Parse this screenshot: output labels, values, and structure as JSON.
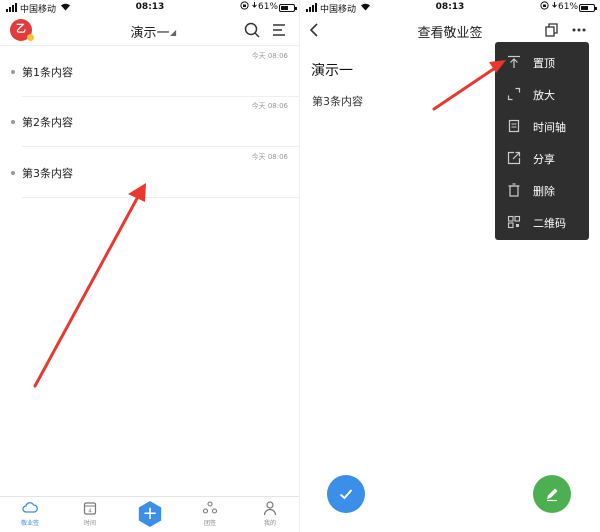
{
  "status_bar": {
    "carrier": "中国移动",
    "time": "08:13",
    "battery_pct": "61%",
    "battery_level": 0.61
  },
  "list_screen": {
    "title": "演示一",
    "logo_text": "乙",
    "notes": [
      {
        "time": "今天 08:06",
        "text": "第1条内容"
      },
      {
        "time": "今天 08:06",
        "text": "第2条内容"
      },
      {
        "time": "今天 08:06",
        "text": "第3条内容"
      }
    ],
    "tabs": [
      {
        "label": "敬业签",
        "icon": "cloud-icon",
        "active": true
      },
      {
        "label": "时间",
        "icon": "calendar-icon",
        "active": false,
        "calendar_day": "4"
      },
      {
        "label": "团签",
        "icon": "group-icon",
        "active": false
      },
      {
        "label": "我的",
        "icon": "person-icon",
        "active": false
      }
    ],
    "add_icon": "plus-icon"
  },
  "detail_screen": {
    "title": "查看敬业签",
    "note_title": "演示一",
    "note_content": "第3条内容",
    "menu": [
      {
        "label": "置顶",
        "icon": "pin-top-icon"
      },
      {
        "label": "放大",
        "icon": "expand-icon"
      },
      {
        "label": "时间轴",
        "icon": "timeline-icon"
      },
      {
        "label": "分享",
        "icon": "share-icon"
      },
      {
        "label": "删除",
        "icon": "trash-icon"
      },
      {
        "label": "二维码",
        "icon": "qrcode-icon"
      }
    ]
  },
  "colors": {
    "accent_blue": "#3b8fe8",
    "logo_red": "#e23b3b",
    "edit_green": "#4caf50",
    "menu_bg": "#2f2f2f",
    "annotation_arrow": "#e8382f"
  }
}
